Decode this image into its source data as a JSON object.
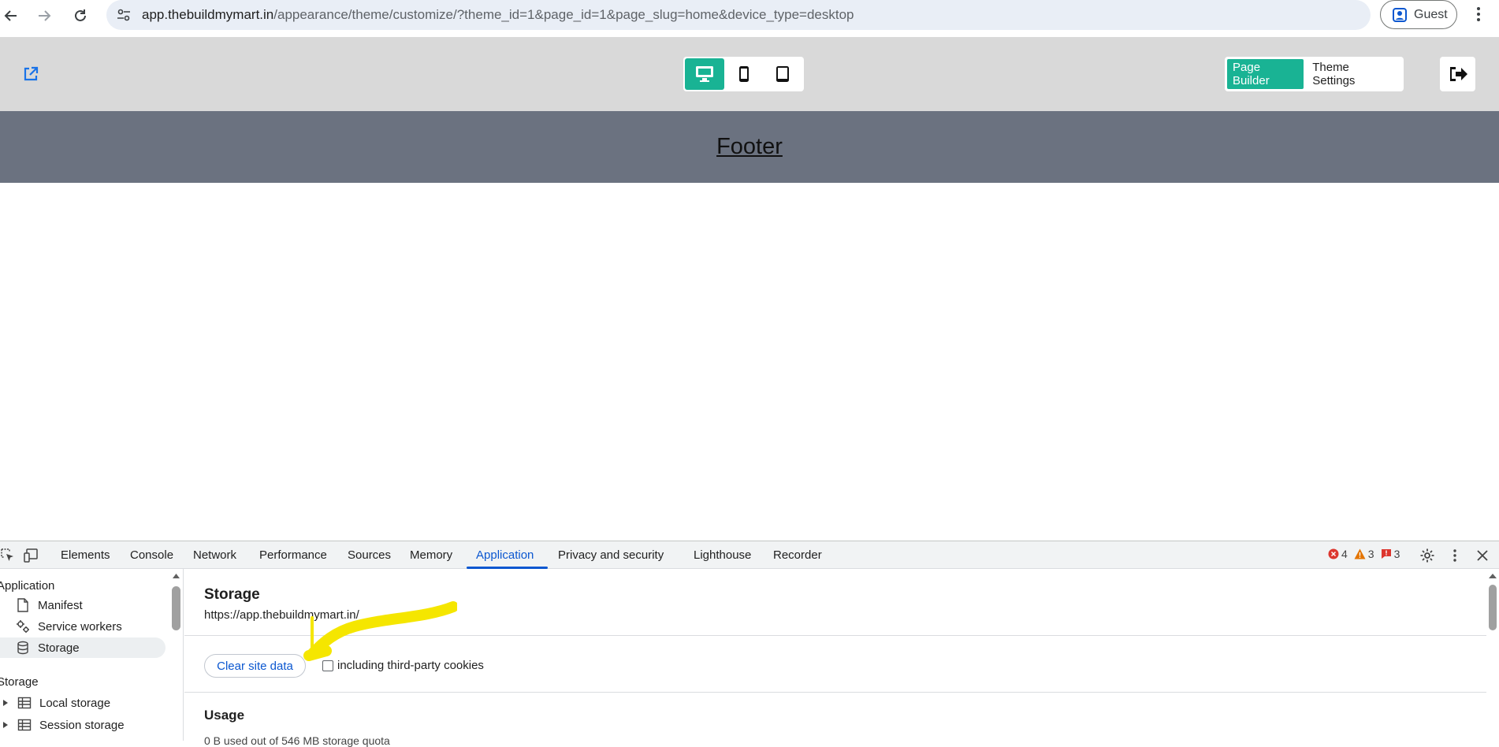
{
  "browser": {
    "url_host": "app.thebuildmymart.in",
    "url_path": "/appearance/theme/customize/?theme_id=1&page_id=1&page_slug=home&device_type=desktop",
    "profile_label": "Guest"
  },
  "header": {
    "device_buttons": [
      "desktop",
      "mobile",
      "tablet"
    ],
    "active_device": "desktop",
    "tabs": [
      {
        "label": "Page Builder",
        "active": true
      },
      {
        "label": "Theme Settings",
        "active": false
      }
    ],
    "accent_color": "#19b394"
  },
  "page": {
    "footer_link": "Footer"
  },
  "devtools": {
    "tabs": [
      {
        "label": "Elements"
      },
      {
        "label": "Console"
      },
      {
        "label": "Network"
      },
      {
        "label": "Performance"
      },
      {
        "label": "Sources"
      },
      {
        "label": "Memory"
      },
      {
        "label": "Application",
        "active": true
      },
      {
        "label": "Privacy and security"
      },
      {
        "label": "Lighthouse"
      },
      {
        "label": "Recorder"
      }
    ],
    "counts": {
      "errors": "4",
      "warnings": "3",
      "issues": "3"
    },
    "sidebar": {
      "section_application": "Application",
      "items": [
        {
          "label": "Manifest",
          "icon": "file-icon"
        },
        {
          "label": "Service workers",
          "icon": "gears-icon"
        },
        {
          "label": "Storage",
          "icon": "database-icon",
          "selected": true
        }
      ],
      "section_storage": "Storage",
      "storage_items": [
        {
          "label": "Local storage",
          "icon": "table-icon"
        },
        {
          "label": "Session storage",
          "icon": "table-icon"
        }
      ]
    },
    "main": {
      "title": "Storage",
      "origin": "https://app.thebuildmymart.in/",
      "clear_button": "Clear site data",
      "checkbox_label": "including third-party cookies",
      "usage_title": "Usage",
      "usage_text": "0 B used out of 546 MB storage quota"
    }
  }
}
